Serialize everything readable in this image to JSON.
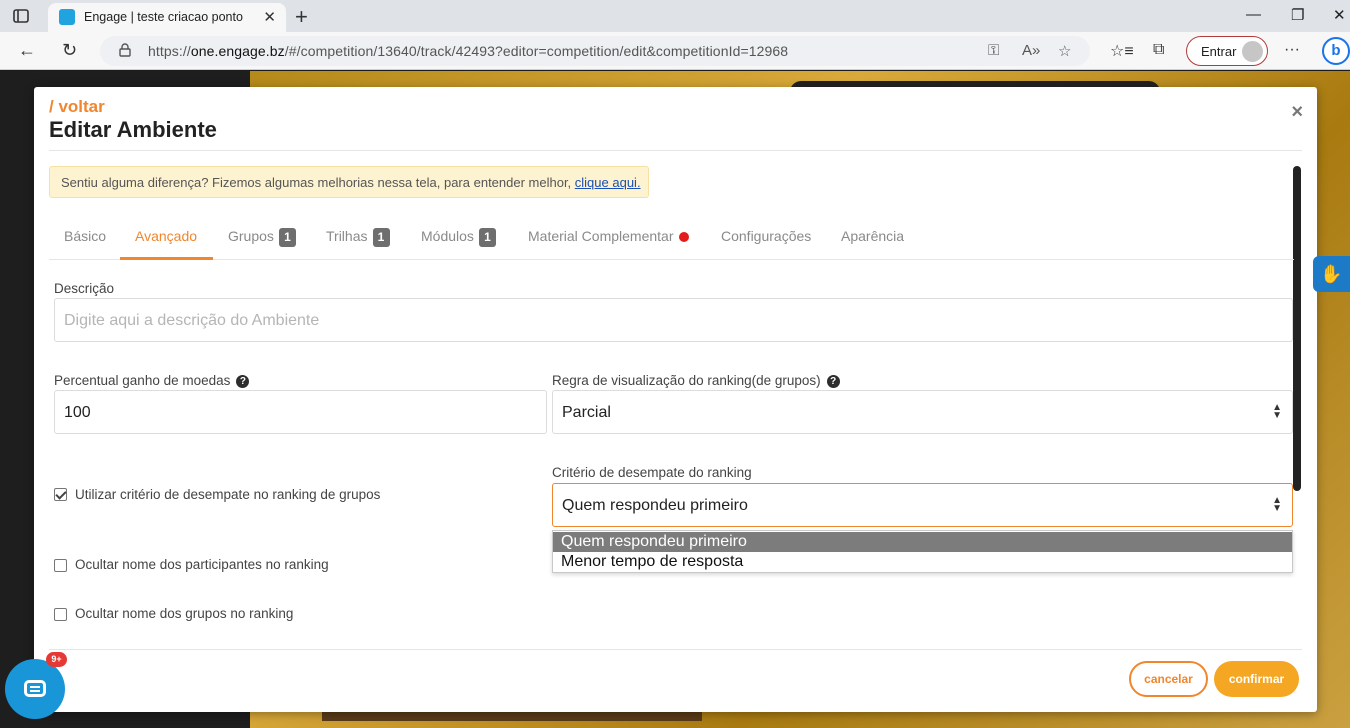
{
  "browser": {
    "tab_title": "Engage | teste criacao ponto",
    "url_prefix": "https://",
    "url_host": "one.engage.bz",
    "url_rest": "/#/competition/13640/track/42493?editor=competition/edit&competitionId=12968",
    "signin_label": "Entrar",
    "bing_label": "b"
  },
  "modal": {
    "back_label": "/ voltar",
    "title": "Editar Ambiente",
    "close_glyph": "×",
    "notice_text": "Sentiu alguma diferença? Fizemos algumas melhorias nessa tela, para entender melhor, ",
    "notice_link": "clique aqui."
  },
  "tabs": [
    {
      "label": "Básico"
    },
    {
      "label": "Avançado",
      "active": true
    },
    {
      "label": "Grupos",
      "badge": "1"
    },
    {
      "label": "Trilhas",
      "badge": "1"
    },
    {
      "label": "Módulos",
      "badge": "1"
    },
    {
      "label": "Material Complementar",
      "dot": true
    },
    {
      "label": "Configurações"
    },
    {
      "label": "Aparência"
    }
  ],
  "form": {
    "description_label": "Descrição",
    "description_placeholder": "Digite aqui a descrição do Ambiente",
    "coins_label": "Percentual ganho de moedas",
    "coins_value": "100",
    "ranking_rule_label": "Regra de visualização do ranking(de grupos)",
    "ranking_rule_value": "Parcial",
    "tiebreak_label": "Critério de desempate do ranking",
    "tiebreak_value": "Quem respondeu primeiro",
    "tiebreak_options": [
      "Quem respondeu primeiro",
      "Menor tempo de resposta"
    ],
    "checkboxes": [
      {
        "label": "Utilizar critério de desempate no ranking de grupos",
        "checked": true
      },
      {
        "label": "Ocultar nome dos participantes no ranking",
        "checked": false
      },
      {
        "label": "Ocultar nome dos grupos no ranking",
        "checked": false
      }
    ],
    "help_glyph": "?"
  },
  "footer": {
    "cancel_label": "cancelar",
    "confirm_label": "confirmar"
  },
  "chat": {
    "badge": "9+"
  },
  "colors": {
    "accent": "#f0862d",
    "confirm": "#f5a623",
    "badge": "#6e6e6e",
    "dot": "#e41b1b"
  }
}
